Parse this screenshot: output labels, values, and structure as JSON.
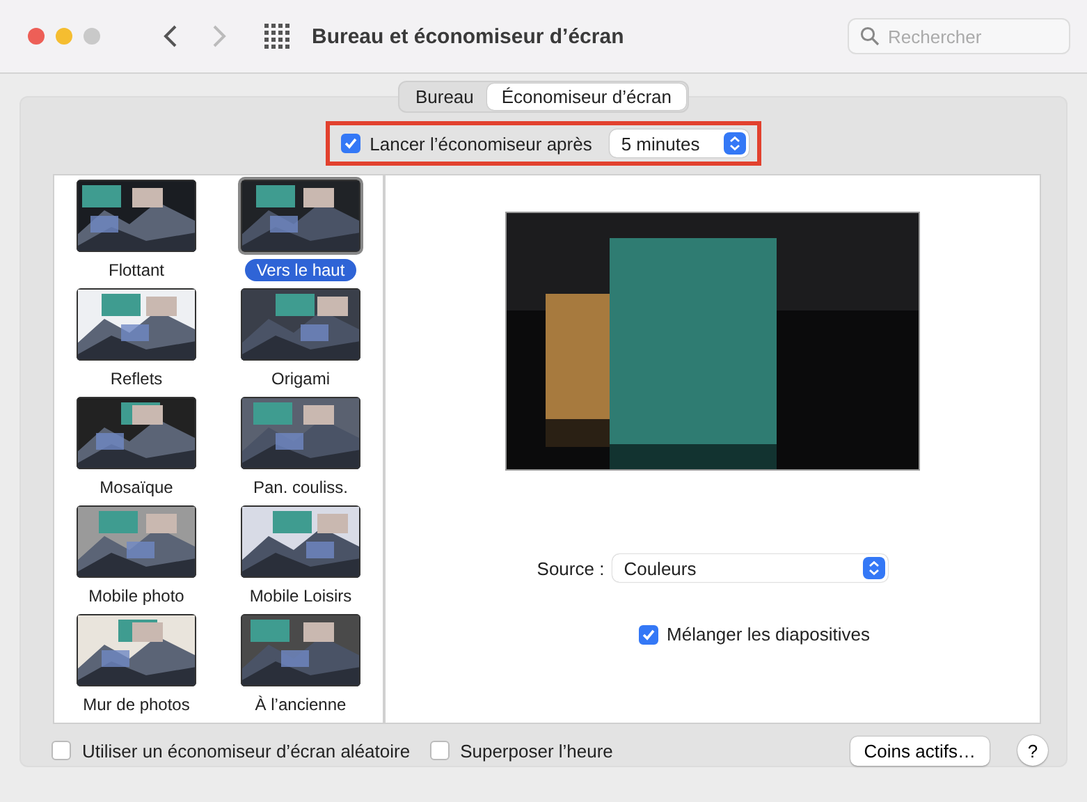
{
  "window": {
    "title": "Bureau et économiseur d’écran",
    "search": {
      "placeholder": "Rechercher"
    }
  },
  "tabs": [
    {
      "label": "Bureau",
      "selected": false
    },
    {
      "label": "Économiseur d’écran",
      "selected": true
    }
  ],
  "start_after": {
    "label": "Lancer l’économiseur après",
    "checked": true,
    "value": "5 minutes"
  },
  "screensavers": [
    {
      "label": "Flottant",
      "selected": false
    },
    {
      "label": "Vers le haut",
      "selected": true
    },
    {
      "label": "Reflets",
      "selected": false
    },
    {
      "label": "Origami",
      "selected": false
    },
    {
      "label": "Mosaïque",
      "selected": false
    },
    {
      "label": "Pan. couliss.",
      "selected": false
    },
    {
      "label": "Mobile photo",
      "selected": false
    },
    {
      "label": "Mobile Loisirs",
      "selected": false
    },
    {
      "label": "Mur de photos",
      "selected": false
    },
    {
      "label": "À l’ancienne",
      "selected": false
    }
  ],
  "preview": {
    "source": {
      "label": "Source :",
      "value": "Couleurs"
    },
    "shuffle": {
      "label": "Mélanger les diapositives",
      "checked": true
    }
  },
  "bottom": {
    "random": {
      "label": "Utiliser un économiseur d’écran aléatoire",
      "checked": false
    },
    "show_clock": {
      "label": "Superposer l’heure",
      "checked": false
    },
    "hot_corners": "Coins actifs…",
    "help": "?"
  }
}
